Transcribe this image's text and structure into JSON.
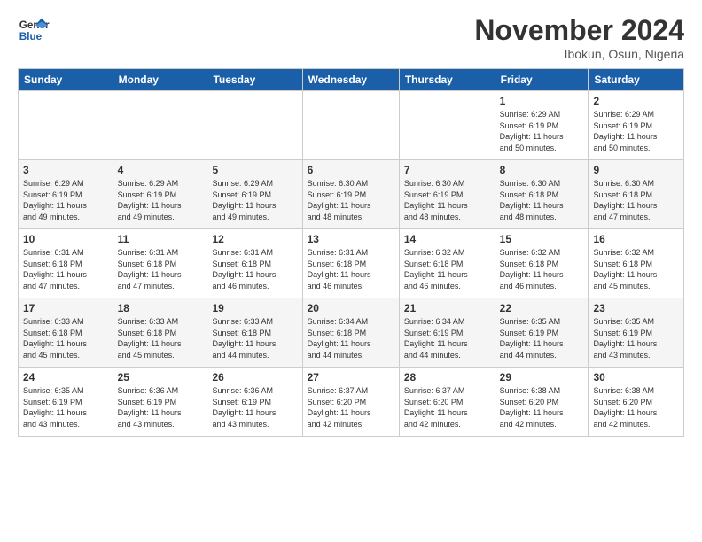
{
  "header": {
    "logo_general": "General",
    "logo_blue": "Blue",
    "title": "November 2024",
    "subtitle": "Ibokun, Osun, Nigeria"
  },
  "weekdays": [
    "Sunday",
    "Monday",
    "Tuesday",
    "Wednesday",
    "Thursday",
    "Friday",
    "Saturday"
  ],
  "weeks": [
    [
      {
        "day": "",
        "info": ""
      },
      {
        "day": "",
        "info": ""
      },
      {
        "day": "",
        "info": ""
      },
      {
        "day": "",
        "info": ""
      },
      {
        "day": "",
        "info": ""
      },
      {
        "day": "1",
        "info": "Sunrise: 6:29 AM\nSunset: 6:19 PM\nDaylight: 11 hours\nand 50 minutes."
      },
      {
        "day": "2",
        "info": "Sunrise: 6:29 AM\nSunset: 6:19 PM\nDaylight: 11 hours\nand 50 minutes."
      }
    ],
    [
      {
        "day": "3",
        "info": "Sunrise: 6:29 AM\nSunset: 6:19 PM\nDaylight: 11 hours\nand 49 minutes."
      },
      {
        "day": "4",
        "info": "Sunrise: 6:29 AM\nSunset: 6:19 PM\nDaylight: 11 hours\nand 49 minutes."
      },
      {
        "day": "5",
        "info": "Sunrise: 6:29 AM\nSunset: 6:19 PM\nDaylight: 11 hours\nand 49 minutes."
      },
      {
        "day": "6",
        "info": "Sunrise: 6:30 AM\nSunset: 6:19 PM\nDaylight: 11 hours\nand 48 minutes."
      },
      {
        "day": "7",
        "info": "Sunrise: 6:30 AM\nSunset: 6:19 PM\nDaylight: 11 hours\nand 48 minutes."
      },
      {
        "day": "8",
        "info": "Sunrise: 6:30 AM\nSunset: 6:18 PM\nDaylight: 11 hours\nand 48 minutes."
      },
      {
        "day": "9",
        "info": "Sunrise: 6:30 AM\nSunset: 6:18 PM\nDaylight: 11 hours\nand 47 minutes."
      }
    ],
    [
      {
        "day": "10",
        "info": "Sunrise: 6:31 AM\nSunset: 6:18 PM\nDaylight: 11 hours\nand 47 minutes."
      },
      {
        "day": "11",
        "info": "Sunrise: 6:31 AM\nSunset: 6:18 PM\nDaylight: 11 hours\nand 47 minutes."
      },
      {
        "day": "12",
        "info": "Sunrise: 6:31 AM\nSunset: 6:18 PM\nDaylight: 11 hours\nand 46 minutes."
      },
      {
        "day": "13",
        "info": "Sunrise: 6:31 AM\nSunset: 6:18 PM\nDaylight: 11 hours\nand 46 minutes."
      },
      {
        "day": "14",
        "info": "Sunrise: 6:32 AM\nSunset: 6:18 PM\nDaylight: 11 hours\nand 46 minutes."
      },
      {
        "day": "15",
        "info": "Sunrise: 6:32 AM\nSunset: 6:18 PM\nDaylight: 11 hours\nand 46 minutes."
      },
      {
        "day": "16",
        "info": "Sunrise: 6:32 AM\nSunset: 6:18 PM\nDaylight: 11 hours\nand 45 minutes."
      }
    ],
    [
      {
        "day": "17",
        "info": "Sunrise: 6:33 AM\nSunset: 6:18 PM\nDaylight: 11 hours\nand 45 minutes."
      },
      {
        "day": "18",
        "info": "Sunrise: 6:33 AM\nSunset: 6:18 PM\nDaylight: 11 hours\nand 45 minutes."
      },
      {
        "day": "19",
        "info": "Sunrise: 6:33 AM\nSunset: 6:18 PM\nDaylight: 11 hours\nand 44 minutes."
      },
      {
        "day": "20",
        "info": "Sunrise: 6:34 AM\nSunset: 6:18 PM\nDaylight: 11 hours\nand 44 minutes."
      },
      {
        "day": "21",
        "info": "Sunrise: 6:34 AM\nSunset: 6:19 PM\nDaylight: 11 hours\nand 44 minutes."
      },
      {
        "day": "22",
        "info": "Sunrise: 6:35 AM\nSunset: 6:19 PM\nDaylight: 11 hours\nand 44 minutes."
      },
      {
        "day": "23",
        "info": "Sunrise: 6:35 AM\nSunset: 6:19 PM\nDaylight: 11 hours\nand 43 minutes."
      }
    ],
    [
      {
        "day": "24",
        "info": "Sunrise: 6:35 AM\nSunset: 6:19 PM\nDaylight: 11 hours\nand 43 minutes."
      },
      {
        "day": "25",
        "info": "Sunrise: 6:36 AM\nSunset: 6:19 PM\nDaylight: 11 hours\nand 43 minutes."
      },
      {
        "day": "26",
        "info": "Sunrise: 6:36 AM\nSunset: 6:19 PM\nDaylight: 11 hours\nand 43 minutes."
      },
      {
        "day": "27",
        "info": "Sunrise: 6:37 AM\nSunset: 6:20 PM\nDaylight: 11 hours\nand 42 minutes."
      },
      {
        "day": "28",
        "info": "Sunrise: 6:37 AM\nSunset: 6:20 PM\nDaylight: 11 hours\nand 42 minutes."
      },
      {
        "day": "29",
        "info": "Sunrise: 6:38 AM\nSunset: 6:20 PM\nDaylight: 11 hours\nand 42 minutes."
      },
      {
        "day": "30",
        "info": "Sunrise: 6:38 AM\nSunset: 6:20 PM\nDaylight: 11 hours\nand 42 minutes."
      }
    ]
  ]
}
